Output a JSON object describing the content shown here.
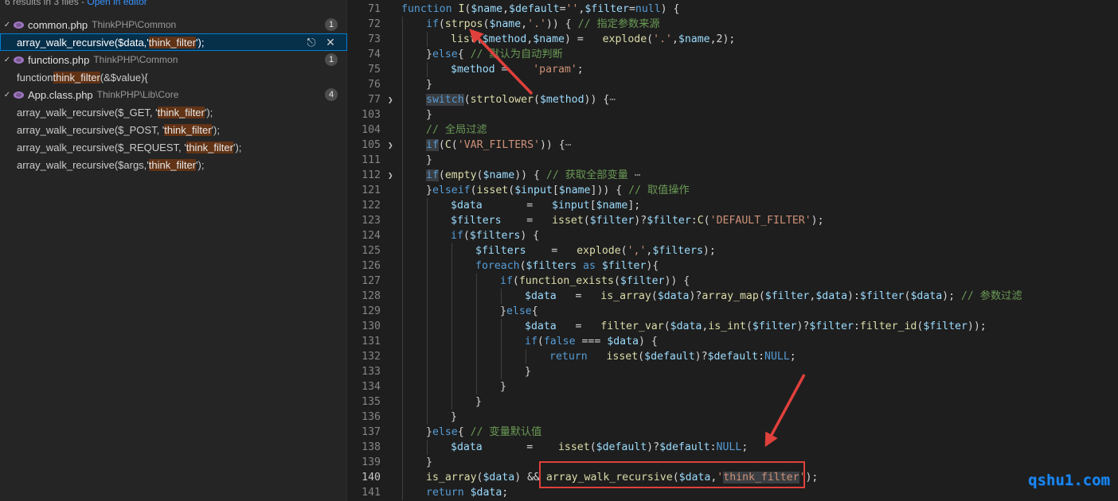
{
  "search": {
    "summary": "6 results in 3 files - ",
    "open_in_editor": "Open in editor",
    "files": [
      {
        "name": "common.php",
        "path": "ThinkPHP\\Common",
        "count": "1",
        "matches": [
          {
            "pre": "array_walk_recursive($data,'",
            "hit": "think_filter",
            "post": "');",
            "selected": true
          }
        ]
      },
      {
        "name": "functions.php",
        "path": "ThinkPHP\\Common",
        "count": "1",
        "matches": [
          {
            "pre": "function ",
            "hit": "think_filter",
            "post": "(&$value){"
          }
        ]
      },
      {
        "name": "App.class.php",
        "path": "ThinkPHP\\Lib\\Core",
        "count": "4",
        "matches": [
          {
            "pre": "array_walk_recursive($_GET,          '",
            "hit": "think_filter",
            "post": "');"
          },
          {
            "pre": "array_walk_recursive($_POST,  '",
            "hit": "think_filter",
            "post": "');"
          },
          {
            "pre": "array_walk_recursive($_REQUEST,   '",
            "hit": "think_filter",
            "post": "');"
          },
          {
            "pre": "array_walk_recursive($args,'",
            "hit": "think_filter",
            "post": "');"
          }
        ]
      }
    ]
  },
  "editor": {
    "lines": [
      {
        "n": "71",
        "fold": false,
        "indent": 0,
        "segs": [
          [
            "kw",
            "function "
          ],
          [
            "fn",
            "I"
          ],
          [
            "pl",
            "("
          ],
          [
            "var",
            "$name"
          ],
          [
            "pl",
            ","
          ],
          [
            "var",
            "$default"
          ],
          [
            "pl",
            "="
          ],
          [
            "str",
            "''"
          ],
          [
            "pl",
            ","
          ],
          [
            "var",
            "$filter"
          ],
          [
            "pl",
            "="
          ],
          [
            "kw",
            "null"
          ],
          [
            "pl",
            ") {"
          ]
        ]
      },
      {
        "n": "72",
        "fold": false,
        "indent": 1,
        "segs": [
          [
            "kw",
            "if"
          ],
          [
            "pl",
            "("
          ],
          [
            "fn",
            "strpos"
          ],
          [
            "pl",
            "("
          ],
          [
            "var",
            "$name"
          ],
          [
            "pl",
            ","
          ],
          [
            "str",
            "'.'"
          ],
          [
            "pl",
            ")) { "
          ],
          [
            "cm",
            "// 指定参数来源"
          ]
        ]
      },
      {
        "n": "73",
        "fold": false,
        "indent": 2,
        "segs": [
          [
            "fn",
            "list"
          ],
          [
            "pl",
            "("
          ],
          [
            "var",
            "$method"
          ],
          [
            "pl",
            ","
          ],
          [
            "var",
            "$name"
          ],
          [
            "pl",
            ") =   "
          ],
          [
            "fn",
            "explode"
          ],
          [
            "pl",
            "("
          ],
          [
            "str",
            "'.'"
          ],
          [
            "pl",
            ","
          ],
          [
            "var",
            "$name"
          ],
          [
            "pl",
            ",2);"
          ]
        ]
      },
      {
        "n": "74",
        "fold": false,
        "indent": 1,
        "segs": [
          [
            "pl",
            "}"
          ],
          [
            "kw",
            "else"
          ],
          [
            "pl",
            "{ "
          ],
          [
            "cm",
            "// 默认为自动判断"
          ]
        ]
      },
      {
        "n": "75",
        "fold": false,
        "indent": 2,
        "segs": [
          [
            "var",
            "$method"
          ],
          [
            "pl",
            " =    "
          ],
          [
            "str",
            "'param'"
          ],
          [
            "pl",
            ";"
          ]
        ]
      },
      {
        "n": "76",
        "fold": false,
        "indent": 1,
        "segs": [
          [
            "pl",
            "}"
          ]
        ]
      },
      {
        "n": "77",
        "fold": true,
        "indent": 1,
        "sel": true,
        "segs": [
          [
            "kw",
            "switch"
          ],
          [
            "pl",
            "("
          ],
          [
            "fn",
            "strtolower"
          ],
          [
            "pl",
            "("
          ],
          [
            "var",
            "$method"
          ],
          [
            "pl",
            ")) {"
          ],
          [
            "folded",
            "⋯"
          ]
        ]
      },
      {
        "n": "103",
        "fold": false,
        "indent": 1,
        "segs": [
          [
            "pl",
            "}"
          ]
        ]
      },
      {
        "n": "104",
        "fold": false,
        "indent": 1,
        "segs": [
          [
            "cm",
            "// 全局过滤"
          ]
        ]
      },
      {
        "n": "105",
        "fold": true,
        "indent": 1,
        "sel": true,
        "segs": [
          [
            "kw",
            "if"
          ],
          [
            "pl",
            "("
          ],
          [
            "fn",
            "C"
          ],
          [
            "pl",
            "("
          ],
          [
            "str",
            "'VAR_FILTERS'"
          ],
          [
            "pl",
            ")) {"
          ],
          [
            "folded",
            "⋯"
          ]
        ]
      },
      {
        "n": "111",
        "fold": false,
        "indent": 1,
        "segs": [
          [
            "pl",
            "}"
          ]
        ]
      },
      {
        "n": "112",
        "fold": true,
        "indent": 1,
        "sel": true,
        "segs": [
          [
            "kw",
            "if"
          ],
          [
            "pl",
            "("
          ],
          [
            "fn",
            "empty"
          ],
          [
            "pl",
            "("
          ],
          [
            "var",
            "$name"
          ],
          [
            "pl",
            ")) { "
          ],
          [
            "cm",
            "// 获取全部变量 "
          ],
          [
            "folded",
            "⋯"
          ]
        ]
      },
      {
        "n": "121",
        "fold": false,
        "indent": 1,
        "segs": [
          [
            "pl",
            "}"
          ],
          [
            "kw",
            "elseif"
          ],
          [
            "pl",
            "("
          ],
          [
            "fn",
            "isset"
          ],
          [
            "pl",
            "("
          ],
          [
            "var",
            "$input"
          ],
          [
            "pl",
            "["
          ],
          [
            "var",
            "$name"
          ],
          [
            "pl",
            "])) { "
          ],
          [
            "cm",
            "// 取值操作"
          ]
        ]
      },
      {
        "n": "122",
        "fold": false,
        "indent": 2,
        "segs": [
          [
            "var",
            "$data"
          ],
          [
            "pl",
            "       =   "
          ],
          [
            "var",
            "$input"
          ],
          [
            "pl",
            "["
          ],
          [
            "var",
            "$name"
          ],
          [
            "pl",
            "];"
          ]
        ]
      },
      {
        "n": "123",
        "fold": false,
        "indent": 2,
        "segs": [
          [
            "var",
            "$filters"
          ],
          [
            "pl",
            "    =   "
          ],
          [
            "fn",
            "isset"
          ],
          [
            "pl",
            "("
          ],
          [
            "var",
            "$filter"
          ],
          [
            "pl",
            ")?"
          ],
          [
            "var",
            "$filter"
          ],
          [
            "pl",
            ":"
          ],
          [
            "fn",
            "C"
          ],
          [
            "pl",
            "("
          ],
          [
            "str",
            "'DEFAULT_FILTER'"
          ],
          [
            "pl",
            ");"
          ]
        ]
      },
      {
        "n": "124",
        "fold": false,
        "indent": 2,
        "segs": [
          [
            "kw",
            "if"
          ],
          [
            "pl",
            "("
          ],
          [
            "var",
            "$filters"
          ],
          [
            "pl",
            ") {"
          ]
        ]
      },
      {
        "n": "125",
        "fold": false,
        "indent": 3,
        "segs": [
          [
            "var",
            "$filters"
          ],
          [
            "pl",
            "    =   "
          ],
          [
            "fn",
            "explode"
          ],
          [
            "pl",
            "("
          ],
          [
            "str",
            "','"
          ],
          [
            "pl",
            ","
          ],
          [
            "var",
            "$filters"
          ],
          [
            "pl",
            ");"
          ]
        ]
      },
      {
        "n": "126",
        "fold": false,
        "indent": 3,
        "segs": [
          [
            "kw",
            "foreach"
          ],
          [
            "pl",
            "("
          ],
          [
            "var",
            "$filters"
          ],
          [
            "kw",
            " as "
          ],
          [
            "var",
            "$filter"
          ],
          [
            "pl",
            "){"
          ]
        ]
      },
      {
        "n": "127",
        "fold": false,
        "indent": 4,
        "segs": [
          [
            "kw",
            "if"
          ],
          [
            "pl",
            "("
          ],
          [
            "fn",
            "function_exists"
          ],
          [
            "pl",
            "("
          ],
          [
            "var",
            "$filter"
          ],
          [
            "pl",
            ")) {"
          ]
        ]
      },
      {
        "n": "128",
        "fold": false,
        "indent": 5,
        "segs": [
          [
            "var",
            "$data"
          ],
          [
            "pl",
            "   =   "
          ],
          [
            "fn",
            "is_array"
          ],
          [
            "pl",
            "("
          ],
          [
            "var",
            "$data"
          ],
          [
            "pl",
            ")?"
          ],
          [
            "fn",
            "array_map"
          ],
          [
            "pl",
            "("
          ],
          [
            "var",
            "$filter"
          ],
          [
            "pl",
            ","
          ],
          [
            "var",
            "$data"
          ],
          [
            "pl",
            "):"
          ],
          [
            "var",
            "$filter"
          ],
          [
            "pl",
            "("
          ],
          [
            "var",
            "$data"
          ],
          [
            "pl",
            "); "
          ],
          [
            "cm",
            "// 参数过滤"
          ]
        ]
      },
      {
        "n": "129",
        "fold": false,
        "indent": 4,
        "segs": [
          [
            "pl",
            "}"
          ],
          [
            "kw",
            "else"
          ],
          [
            "pl",
            "{"
          ]
        ]
      },
      {
        "n": "130",
        "fold": false,
        "indent": 5,
        "segs": [
          [
            "var",
            "$data"
          ],
          [
            "pl",
            "   =   "
          ],
          [
            "fn",
            "filter_var"
          ],
          [
            "pl",
            "("
          ],
          [
            "var",
            "$data"
          ],
          [
            "pl",
            ","
          ],
          [
            "fn",
            "is_int"
          ],
          [
            "pl",
            "("
          ],
          [
            "var",
            "$filter"
          ],
          [
            "pl",
            ")?"
          ],
          [
            "var",
            "$filter"
          ],
          [
            "pl",
            ":"
          ],
          [
            "fn",
            "filter_id"
          ],
          [
            "pl",
            "("
          ],
          [
            "var",
            "$filter"
          ],
          [
            "pl",
            "));"
          ]
        ]
      },
      {
        "n": "131",
        "fold": false,
        "indent": 5,
        "segs": [
          [
            "kw",
            "if"
          ],
          [
            "pl",
            "("
          ],
          [
            "kw",
            "false"
          ],
          [
            "pl",
            " === "
          ],
          [
            "var",
            "$data"
          ],
          [
            "pl",
            ") {"
          ]
        ]
      },
      {
        "n": "132",
        "fold": false,
        "indent": 6,
        "segs": [
          [
            "kw",
            "return"
          ],
          [
            "pl",
            "   "
          ],
          [
            "fn",
            "isset"
          ],
          [
            "pl",
            "("
          ],
          [
            "var",
            "$default"
          ],
          [
            "pl",
            ")?"
          ],
          [
            "var",
            "$default"
          ],
          [
            "pl",
            ":"
          ],
          [
            "kw",
            "NULL"
          ],
          [
            "pl",
            ";"
          ]
        ]
      },
      {
        "n": "133",
        "fold": false,
        "indent": 5,
        "segs": [
          [
            "pl",
            "}"
          ]
        ]
      },
      {
        "n": "134",
        "fold": false,
        "indent": 4,
        "segs": [
          [
            "pl",
            "}"
          ]
        ]
      },
      {
        "n": "135",
        "fold": false,
        "indent": 3,
        "segs": [
          [
            "pl",
            "}"
          ]
        ]
      },
      {
        "n": "136",
        "fold": false,
        "indent": 2,
        "segs": [
          [
            "pl",
            "}"
          ]
        ]
      },
      {
        "n": "137",
        "fold": false,
        "indent": 1,
        "segs": [
          [
            "pl",
            "}"
          ],
          [
            "kw",
            "else"
          ],
          [
            "pl",
            "{ "
          ],
          [
            "cm",
            "// 变量默认值"
          ]
        ]
      },
      {
        "n": "138",
        "fold": false,
        "indent": 2,
        "segs": [
          [
            "var",
            "$data"
          ],
          [
            "pl",
            "       =    "
          ],
          [
            "fn",
            "isset"
          ],
          [
            "pl",
            "("
          ],
          [
            "var",
            "$default"
          ],
          [
            "pl",
            ")?"
          ],
          [
            "var",
            "$default"
          ],
          [
            "pl",
            ":"
          ],
          [
            "kw",
            "NULL"
          ],
          [
            "pl",
            ";"
          ]
        ]
      },
      {
        "n": "139",
        "fold": false,
        "indent": 1,
        "segs": [
          [
            "pl",
            "}"
          ]
        ]
      },
      {
        "n": "140",
        "fold": false,
        "indent": 1,
        "active": true,
        "segs": [
          [
            "fn",
            "is_array"
          ],
          [
            "pl",
            "("
          ],
          [
            "var",
            "$data"
          ],
          [
            "pl",
            ") && "
          ],
          [
            "fn",
            "array_walk_recursive"
          ],
          [
            "pl",
            "("
          ],
          [
            "var",
            "$data"
          ],
          [
            "pl",
            ","
          ],
          [
            "str",
            "'"
          ],
          [
            "strsel",
            "think_filter"
          ],
          [
            "str",
            "'"
          ],
          [
            "pl",
            ");"
          ]
        ]
      },
      {
        "n": "141",
        "fold": false,
        "indent": 1,
        "segs": [
          [
            "kw",
            "return"
          ],
          [
            "pl",
            " "
          ],
          [
            "var",
            "$data"
          ],
          [
            "pl",
            ";"
          ]
        ]
      }
    ]
  },
  "watermark": "qshu1.com",
  "colors": {
    "annotation_red": "#e0403c",
    "accent": "#007fd4",
    "match_highlight": "#623315"
  }
}
